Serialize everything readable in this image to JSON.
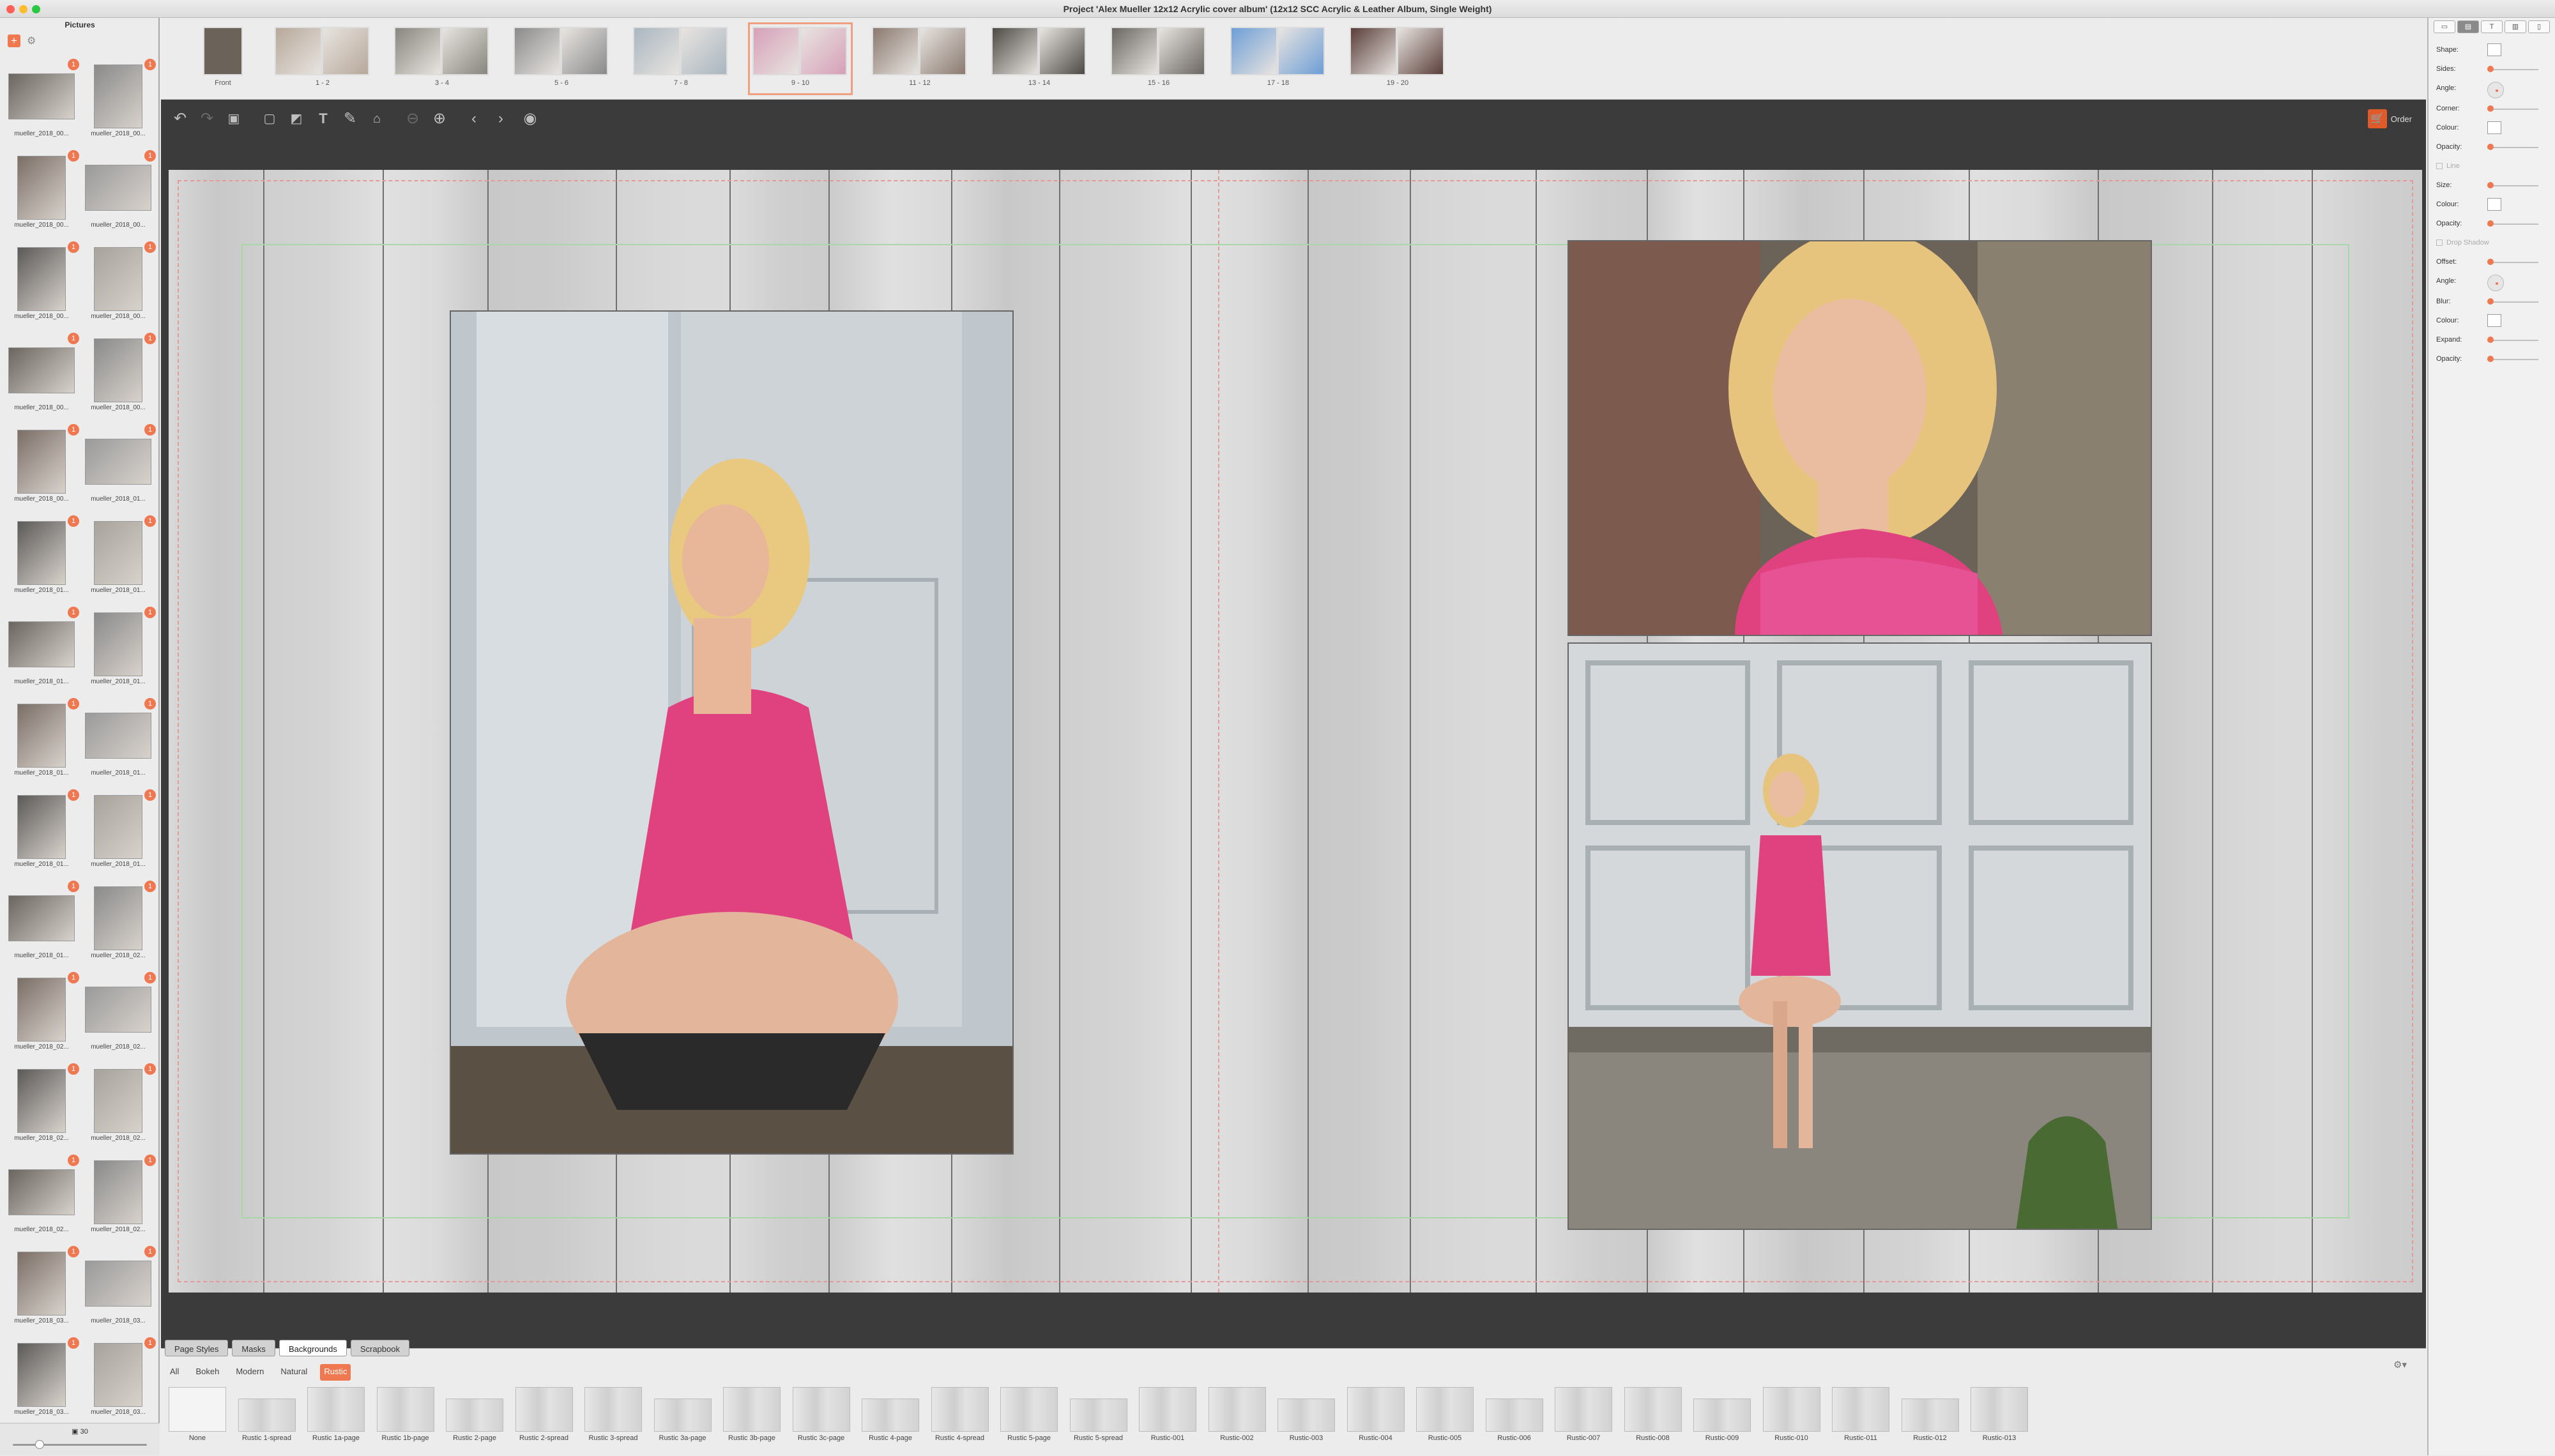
{
  "window": {
    "title": "Project 'Alex Mueller 12x12 Acrylic cover album' (12x12 SCC Acrylic & Leather Album, Single Weight)"
  },
  "sidebar": {
    "header": "Pictures",
    "add_icon": "plus-icon",
    "settings_icon": "gear-icon",
    "pictures": [
      {
        "label": "mueller_2018_00...",
        "badge": "1"
      },
      {
        "label": "mueller_2018_00...",
        "badge": "1"
      },
      {
        "label": "mueller_2018_00...",
        "badge": "1"
      },
      {
        "label": "mueller_2018_00...",
        "badge": "1"
      },
      {
        "label": "mueller_2018_00...",
        "badge": "1"
      },
      {
        "label": "mueller_2018_00...",
        "badge": "1"
      },
      {
        "label": "mueller_2018_00...",
        "badge": "1"
      },
      {
        "label": "mueller_2018_00...",
        "badge": "1"
      },
      {
        "label": "mueller_2018_00...",
        "badge": "1"
      },
      {
        "label": "mueller_2018_01...",
        "badge": "1"
      },
      {
        "label": "mueller_2018_01...",
        "badge": "1"
      },
      {
        "label": "mueller_2018_01...",
        "badge": "1"
      },
      {
        "label": "mueller_2018_01...",
        "badge": "1"
      },
      {
        "label": "mueller_2018_01...",
        "badge": "1"
      },
      {
        "label": "mueller_2018_01...",
        "badge": "1"
      },
      {
        "label": "mueller_2018_01...",
        "badge": "1"
      },
      {
        "label": "mueller_2018_01...",
        "badge": "1"
      },
      {
        "label": "mueller_2018_01...",
        "badge": "1"
      },
      {
        "label": "mueller_2018_01...",
        "badge": "1"
      },
      {
        "label": "mueller_2018_02...",
        "badge": "1"
      },
      {
        "label": "mueller_2018_02...",
        "badge": "1"
      },
      {
        "label": "mueller_2018_02...",
        "badge": "1"
      },
      {
        "label": "mueller_2018_02...",
        "badge": "1"
      },
      {
        "label": "mueller_2018_02...",
        "badge": "1"
      },
      {
        "label": "mueller_2018_02...",
        "badge": "1"
      },
      {
        "label": "mueller_2018_02...",
        "badge": "1"
      },
      {
        "label": "mueller_2018_03...",
        "badge": "1"
      },
      {
        "label": "mueller_2018_03...",
        "badge": "1"
      },
      {
        "label": "mueller_2018_03...",
        "badge": "1"
      },
      {
        "label": "mueller_2018_03...",
        "badge": "1"
      }
    ],
    "footer_count": "30"
  },
  "spreads": [
    {
      "label": "Front"
    },
    {
      "label": "1 - 2"
    },
    {
      "label": "3 - 4"
    },
    {
      "label": "5 - 6"
    },
    {
      "label": "7 - 8"
    },
    {
      "label": "9 - 10",
      "selected": true
    },
    {
      "label": "11 - 12"
    },
    {
      "label": "13 - 14"
    },
    {
      "label": "15 - 16"
    },
    {
      "label": "17 - 18"
    },
    {
      "label": "19 - 20"
    }
  ],
  "toolbar": {
    "icons": [
      "undo-icon",
      "redo-icon",
      "save-icon",
      "add-page-icon",
      "add-image-icon",
      "add-text-icon",
      "brush-icon",
      "store-icon",
      "zoom-out-icon",
      "zoom-in-icon",
      "previous-icon",
      "next-icon",
      "preview-eye-icon"
    ],
    "order_label": "Order",
    "order_icon": "cart-icon"
  },
  "bottom_panel": {
    "tabs": [
      {
        "label": "Page Styles"
      },
      {
        "label": "Masks"
      },
      {
        "label": "Backgrounds",
        "active": true
      },
      {
        "label": "Scrapbook"
      }
    ],
    "categories": [
      {
        "label": "All"
      },
      {
        "label": "Bokeh"
      },
      {
        "label": "Modern"
      },
      {
        "label": "Natural"
      },
      {
        "label": "Rustic",
        "active": true
      }
    ],
    "backgrounds": [
      "None",
      "Rustic 1-spread",
      "Rustic 1a-page",
      "Rustic 1b-page",
      "Rustic 2-page",
      "Rustic 2-spread",
      "Rustic 3-spread",
      "Rustic 3a-page",
      "Rustic 3b-page",
      "Rustic 3c-page",
      "Rustic 4-page",
      "Rustic 4-spread",
      "Rustic 5-page",
      "Rustic 5-spread",
      "Rustic-001",
      "Rustic-002",
      "Rustic-003",
      "Rustic-004",
      "Rustic-005",
      "Rustic-006",
      "Rustic-007",
      "Rustic-008",
      "Rustic-009",
      "Rustic-010",
      "Rustic-011",
      "Rustic-012",
      "Rustic-013"
    ]
  },
  "inspector": {
    "tabs": [
      "frame-tab-icon",
      "photo-tab-icon",
      "text-tab-icon",
      "layout-tab-icon",
      "page-tab-icon"
    ],
    "fields": [
      {
        "label": "Shape:",
        "kind": "box"
      },
      {
        "label": "Sides:",
        "kind": "slider"
      },
      {
        "label": "Angle:",
        "kind": "dial"
      },
      {
        "label": "Corner:",
        "kind": "slider"
      },
      {
        "label": "Colour:",
        "kind": "box"
      },
      {
        "label": "Opacity:",
        "kind": "slider"
      },
      {
        "label": "Line",
        "kind": "section"
      },
      {
        "label": "Size:",
        "kind": "slider"
      },
      {
        "label": "Colour:",
        "kind": "box"
      },
      {
        "label": "Opacity:",
        "kind": "slider"
      },
      {
        "label": "Drop Shadow",
        "kind": "section"
      },
      {
        "label": "Offset:",
        "kind": "slider"
      },
      {
        "label": "Angle:",
        "kind": "dial"
      },
      {
        "label": "Blur:",
        "kind": "slider"
      },
      {
        "label": "Colour:",
        "kind": "box"
      },
      {
        "label": "Expand:",
        "kind": "slider"
      },
      {
        "label": "Opacity:",
        "kind": "slider"
      }
    ]
  },
  "colors": {
    "accent": "#f07850",
    "workspace": "#3b3b3b",
    "wood": "#d6d6d6",
    "top": "#e0427f"
  }
}
